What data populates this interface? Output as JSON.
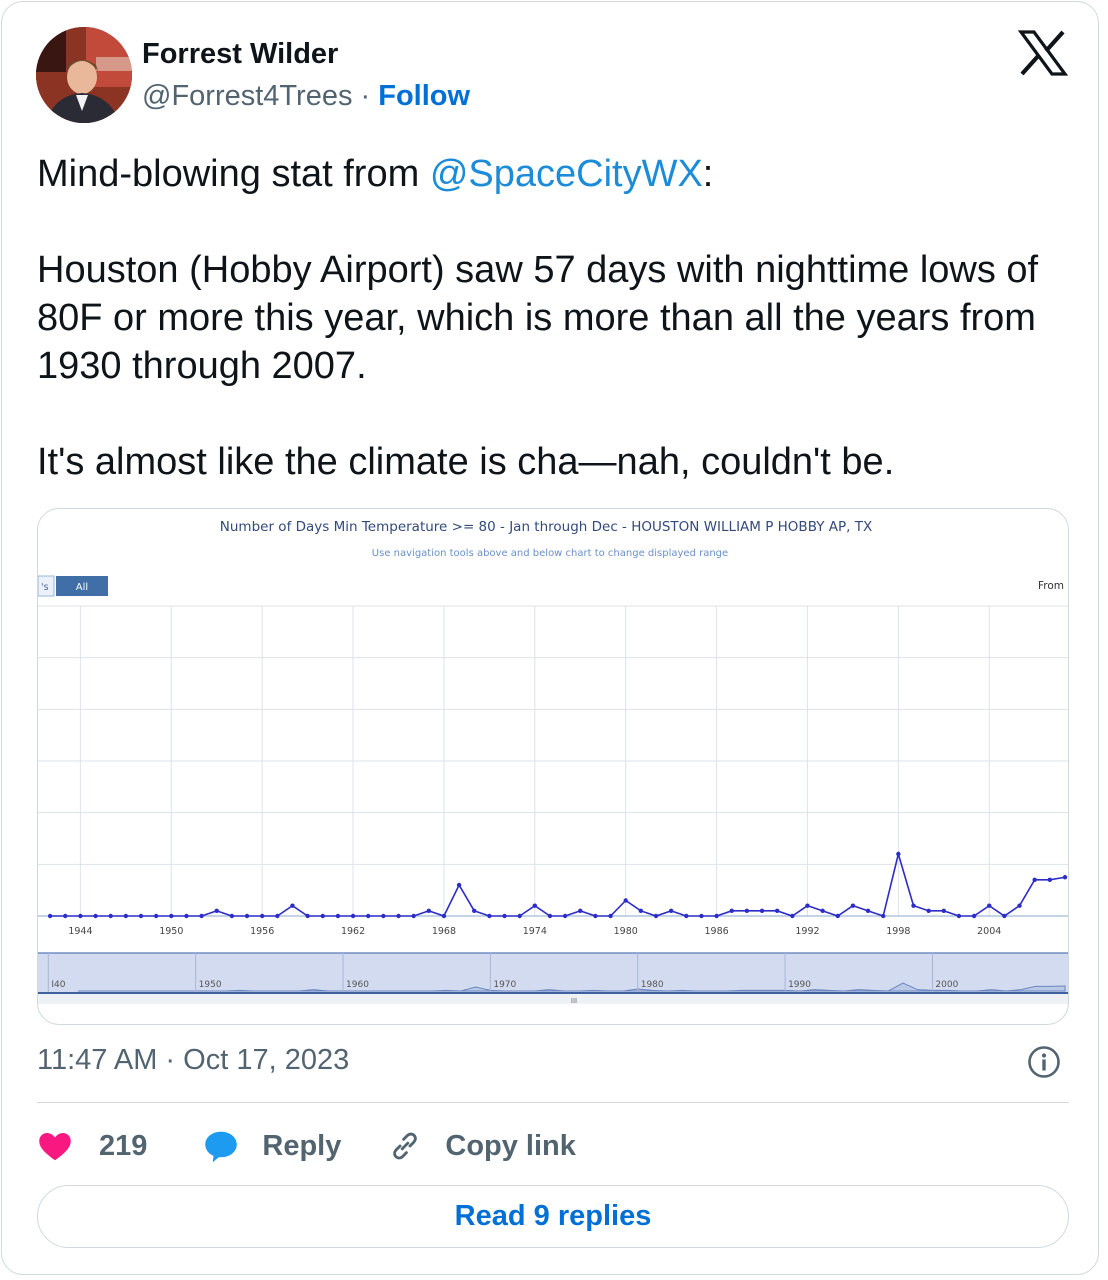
{
  "tweet": {
    "author_name": "Forrest Wilder",
    "author_handle": "@Forrest4Trees",
    "separator": " · ",
    "follow_label": "Follow",
    "text_prefix": "Mind-blowing stat from ",
    "mention": "@SpaceCityWX",
    "text_suffix": ":",
    "paragraph2": "Houston (Hobby Airport) saw 57 days with nighttime lows of 80F or more this year, which is more than all the years from 1930 through 2007.",
    "paragraph3": "It's almost like the climate is cha—nah, couldn't be.",
    "timestamp": "11:47 AM · Oct 17, 2023",
    "likes": "219",
    "reply_label": "Reply",
    "copy_link_label": "Copy link",
    "read_replies_label": "Read 9 replies"
  },
  "icons": {
    "logo": "x-logo-icon",
    "info": "info-icon",
    "like": "heart-icon",
    "reply": "speech-bubble-icon",
    "copy": "link-icon"
  },
  "colors": {
    "link_blue": "#006fd6",
    "mention_blue": "#1d8cd8",
    "heart": "#f91880",
    "reply_bubble": "#1d9bf0",
    "series": "#2c2cc8"
  },
  "chart_data": {
    "type": "line",
    "title": "Number of Days Min Temperature >= 80 - Jan through Dec - HOUSTON WILLIAM P HOBBY AP, TX",
    "subtitle": "Use navigation tools above and below chart to change displayed range",
    "range_button_partial": "'s",
    "range_button_all": "All",
    "from_label": "From",
    "x_ticks": [
      "1944",
      "1950",
      "1956",
      "1962",
      "1968",
      "1974",
      "1980",
      "1986",
      "1992",
      "1998",
      "2004"
    ],
    "navigator_ticks": [
      "I40",
      "1950",
      "1960",
      "1970",
      "1980",
      "1990",
      "2000"
    ],
    "scrollbar_grip": "III",
    "x": [
      1942,
      1943,
      1944,
      1945,
      1946,
      1947,
      1948,
      1949,
      1950,
      1951,
      1952,
      1953,
      1954,
      1955,
      1956,
      1957,
      1958,
      1959,
      1960,
      1961,
      1962,
      1963,
      1964,
      1965,
      1966,
      1967,
      1968,
      1969,
      1970,
      1971,
      1972,
      1973,
      1974,
      1975,
      1976,
      1977,
      1978,
      1979,
      1980,
      1981,
      1982,
      1983,
      1984,
      1985,
      1986,
      1987,
      1988,
      1989,
      1990,
      1991,
      1992,
      1993,
      1994,
      1995,
      1996,
      1997,
      1998,
      1999,
      2000,
      2001,
      2002,
      2003,
      2004,
      2005,
      2006,
      2007,
      2008,
      2009
    ],
    "series": [
      {
        "values": [
          0,
          0,
          0,
          0,
          0,
          0,
          0,
          0,
          0,
          0,
          0,
          1,
          0,
          0,
          0,
          0,
          2,
          0,
          0,
          0,
          0,
          0,
          0,
          0,
          0,
          1,
          0,
          6,
          1,
          0,
          0,
          0,
          2,
          0,
          0,
          1,
          0,
          0,
          3,
          1,
          0,
          1,
          0,
          0,
          0,
          1,
          1,
          1,
          1,
          0,
          2,
          1,
          0,
          2,
          1,
          0,
          12,
          2,
          1,
          1,
          0,
          0,
          2,
          0,
          2,
          7,
          7,
          7.5
        ]
      }
    ],
    "ylim": [
      0,
      60
    ],
    "grid": true
  }
}
